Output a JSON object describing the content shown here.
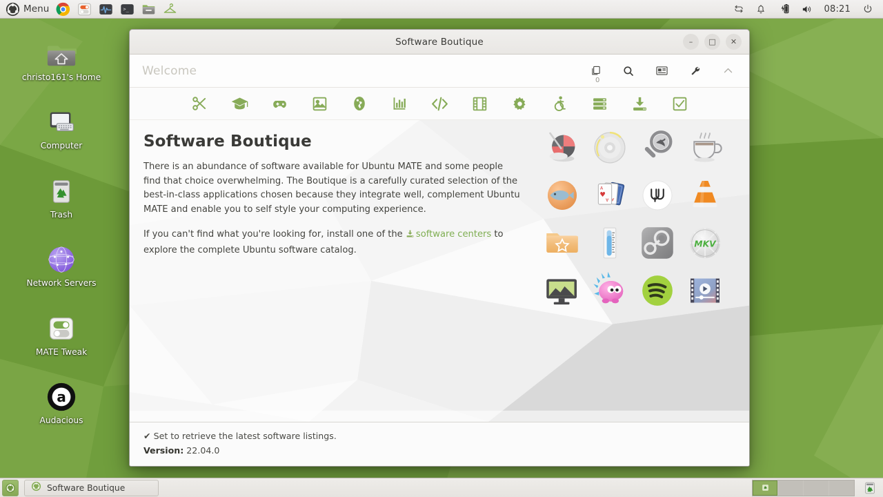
{
  "desktop": {
    "wallpaper_colors": [
      "#6d9c3c",
      "#7aa444",
      "#86ae51",
      "#719f40",
      "#5f8f34"
    ],
    "icons": [
      {
        "name": "home-folder-icon",
        "label": "christo161's Home"
      },
      {
        "name": "computer-icon",
        "label": "Computer"
      },
      {
        "name": "trash-icon",
        "label": "Trash"
      },
      {
        "name": "network-servers-icon",
        "label": "Network Servers"
      },
      {
        "name": "mate-tweak-icon",
        "label": "MATE Tweak"
      },
      {
        "name": "audacious-icon",
        "label": "Audacious"
      }
    ]
  },
  "top_panel": {
    "menu_label": "Menu",
    "launchers": [
      "chrome-icon",
      "mate-tweak-icon",
      "system-monitor-icon",
      "terminal-icon",
      "file-manager-icon",
      "hanger-icon"
    ],
    "tray": [
      "rotation-icon",
      "notification-bell-icon",
      "battery-charging-icon",
      "volume-icon"
    ],
    "clock": "08:21",
    "power_icon": "power-icon"
  },
  "window": {
    "title": "Software Boutique",
    "controls": {
      "minimize": "–",
      "maximize": "□",
      "close": "✕"
    },
    "toolbar": {
      "section_label": "Welcome",
      "tools": [
        {
          "name": "pending-changes-icon",
          "badge": "0"
        },
        {
          "name": "search-icon",
          "badge": ""
        },
        {
          "name": "news-icon",
          "badge": ""
        },
        {
          "name": "settings-wrench-icon",
          "badge": ""
        },
        {
          "name": "collapse-chevron-up-icon",
          "badge": ""
        }
      ]
    },
    "categories": [
      "accessories-scissors-icon",
      "education-graduation-cap-icon",
      "games-gamepad-icon",
      "graphics-image-icon",
      "internet-globe-icon",
      "office-chart-icon",
      "development-code-icon",
      "multimedia-film-icon",
      "system-gear-icon",
      "universal-access-icon",
      "servers-icon",
      "software-centers-download-icon",
      "installed-check-icon"
    ],
    "content": {
      "heading": "Software Boutique",
      "paragraph1": "There is an abundance of software available for Ubuntu MATE and some people find that choice overwhelming. The Boutique is a carefully curated selection of the best-in-class applications chosen because they integrate well, complement Ubuntu MATE and enable you to self style your computing experience.",
      "paragraph2_before": "If you can't find what you're looking for, install one of the ",
      "paragraph2_link": "software centers",
      "paragraph2_after": " to explore the complete Ubuntu software catalog."
    },
    "app_showcase": [
      "blender-icon",
      "brasero-disc-icon",
      "catfish-search-icon",
      "cawbird-coffee-icon",
      "clementine-fish-icon",
      "aisleriot-cards-icon",
      "wire-icon",
      "vlc-cone-icon",
      "favourites-folder-icon",
      "thermometer-icon",
      "steam-icon",
      "makemkv-icon",
      "display-wallpaper-icon",
      "supertux-creature-icon",
      "spotify-icon",
      "video-editor-icon"
    ],
    "statusbar": {
      "status_icon": "✔",
      "status_text": "Set to retrieve the latest software listings.",
      "version_label": "Version:",
      "version_value": "22.04.0"
    }
  },
  "bottom_panel": {
    "show_desktop_icon": "show-desktop-icon",
    "tasks": [
      {
        "icon": "software-boutique-icon",
        "label": "Software Boutique"
      }
    ],
    "workspace_count": 4,
    "active_workspace": 1,
    "trash_icon": "trash-applet-icon"
  }
}
